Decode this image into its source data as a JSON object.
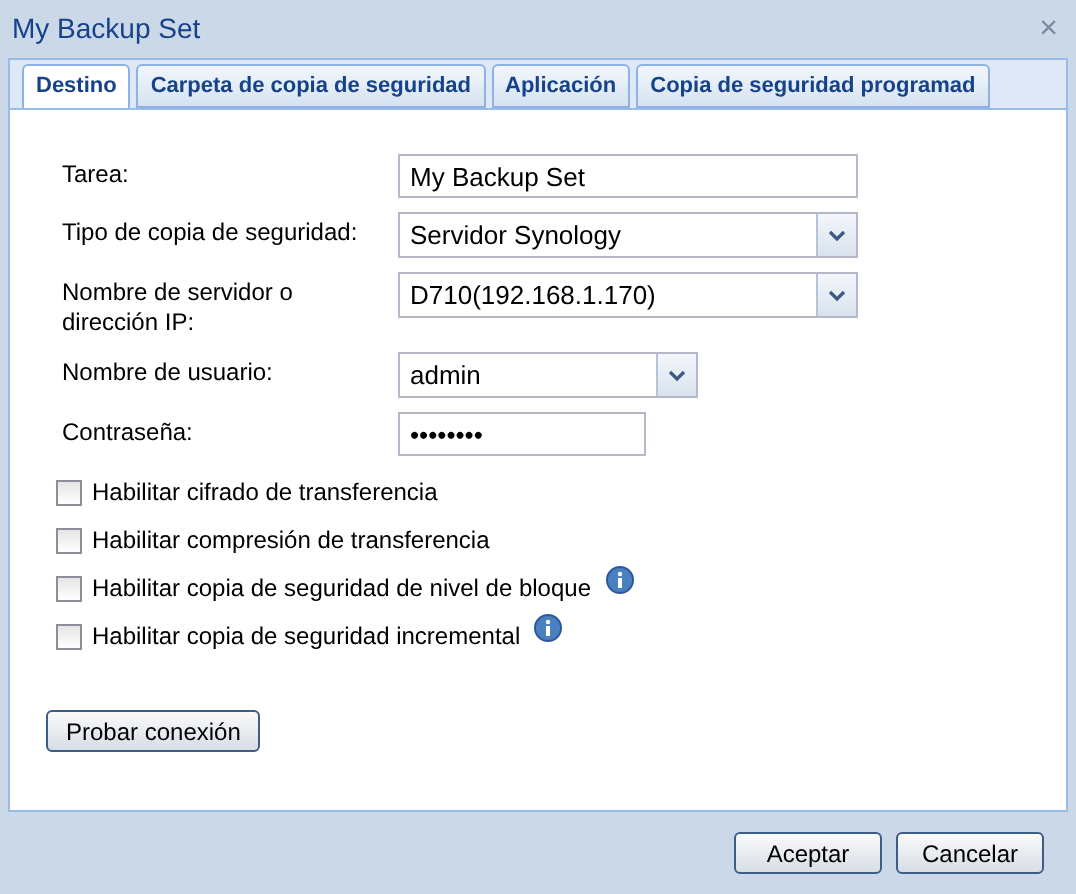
{
  "window": {
    "title": "My Backup Set",
    "close": "×"
  },
  "tabs": [
    {
      "label": "Destino",
      "selected": true
    },
    {
      "label": "Carpeta de copia de seguridad",
      "selected": false
    },
    {
      "label": "Aplicación",
      "selected": false
    },
    {
      "label": "Copia de seguridad programad",
      "selected": false
    }
  ],
  "fields": [
    {
      "kind": "text",
      "label": "Tarea:",
      "value": "My Backup Set"
    },
    {
      "kind": "select",
      "label": "Tipo de copia de seguridad:",
      "value": "Servidor Synology"
    },
    {
      "kind": "select",
      "label": "Nombre de servidor o dirección IP:",
      "value": "D710(192.168.1.170)"
    },
    {
      "kind": "select-short",
      "label": "Nombre de usuario:",
      "value": "admin"
    },
    {
      "kind": "password",
      "label": "Contraseña:",
      "value": "••••••••"
    }
  ],
  "options": [
    {
      "label": "Habilitar cifrado de transferencia",
      "checked": false,
      "info": false
    },
    {
      "label": "Habilitar compresión de transferencia",
      "checked": false,
      "info": false
    },
    {
      "label": "Habilitar copia de seguridad de nivel de bloque",
      "checked": false,
      "info": true
    },
    {
      "label": "Habilitar copia de seguridad incremental",
      "checked": false,
      "info": true
    }
  ],
  "test_button": "Probar conexión",
  "buttons": [
    "Aceptar",
    "Cancelar"
  ]
}
